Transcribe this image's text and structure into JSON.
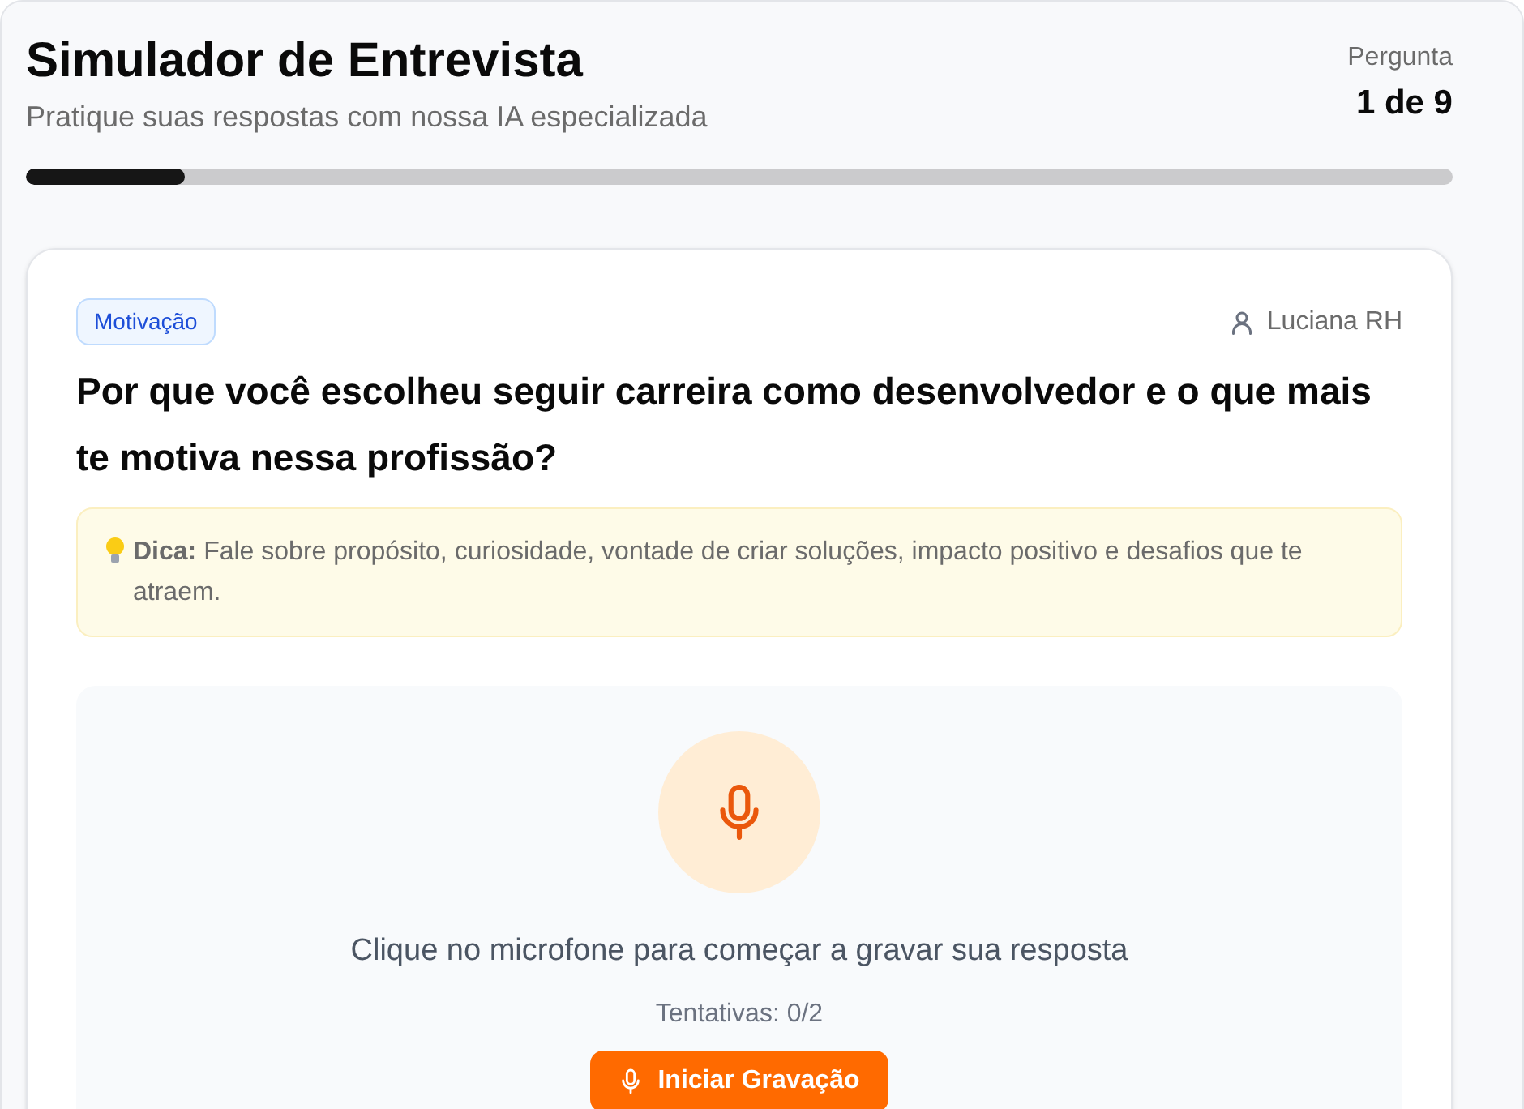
{
  "header": {
    "title": "Simulador de Entrevista",
    "subtitle": "Pratique suas respostas com nossa IA especializada",
    "counter_label": "Pergunta",
    "counter_value": "1 de 9"
  },
  "progress": {
    "level": 0.111
  },
  "question_card": {
    "category": "Motivação",
    "interviewer": "Luciana RH",
    "question": "Por que você escolheu seguir carreira como desenvolvedor e o que mais te motiva nessa profissão?",
    "tip": "**Dica:** Fale sobre propósito, curiosidade, vontade de criar soluções, impacto positivo e desafios que te atraem."
  },
  "recorder": {
    "instruction": "Clique no microfone para começar a gravar sua resposta",
    "attempts": "Tentativas: 0/2",
    "button": "Iniciar Gravação"
  }
}
